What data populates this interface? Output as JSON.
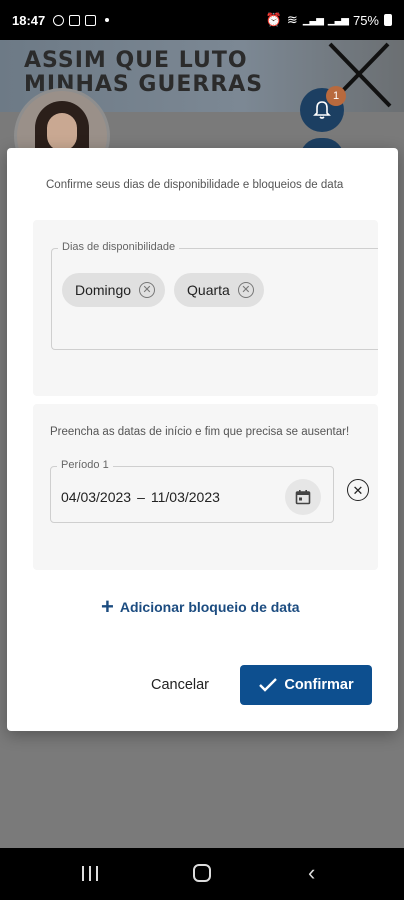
{
  "status_bar": {
    "time": "18:47",
    "battery": "75%",
    "signal_1": "4G",
    "signal_2": "4G"
  },
  "background": {
    "banner_line_1": "ASSIM QUE LUTO",
    "banner_line_2": "MINHAS GUERRAS",
    "notification_count": "1"
  },
  "dialog": {
    "subtitle": "Confirme seus dias de disponibilidade e bloqueios de data",
    "availability": {
      "legend": "Dias de disponibilidade",
      "chips": [
        {
          "label": "Domingo"
        },
        {
          "label": "Quarta"
        }
      ]
    },
    "blocks": {
      "hint": "Preencha as datas de início e fim que precisa se ausentar!",
      "period": {
        "legend": "Período 1",
        "start": "04/03/2023",
        "separator": "–",
        "end": "11/03/2023"
      }
    },
    "add_block_label": "Adicionar bloqueio de data",
    "cancel_label": "Cancelar",
    "confirm_label": "Confirmar"
  },
  "colors": {
    "primary": "#0d4f8f",
    "link": "#1c4c80",
    "badge": "#b96a3e",
    "chip_bg": "#e0e0e0"
  },
  "icons": {
    "chip_remove": "close-circle-icon",
    "calendar": "calendar-icon",
    "remove_period": "close-circle-icon",
    "add": "plus-icon",
    "confirm": "check-icon",
    "bell": "bell-icon"
  }
}
